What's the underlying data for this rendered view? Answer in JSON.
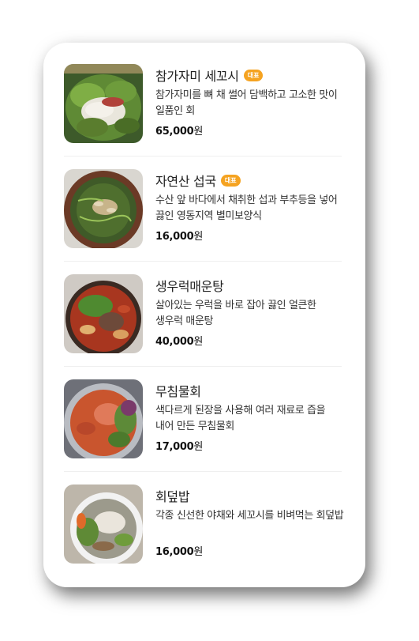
{
  "menu": {
    "items": [
      {
        "name": "참가자미 세꼬시",
        "badge": "대표",
        "description": "참가자미를 뼈 채 썰어 담백하고 고소한 맛이 일품인 회",
        "price": "65,000",
        "currency": "원",
        "image": "sliced-raw-flounder-with-greens"
      },
      {
        "name": "자연산 섭국",
        "badge": "대표",
        "description": "수산 앞 바다에서 채취한 섭과 부추등을 넣어 끓인 영동지역 별미보양식",
        "price": "16,000",
        "currency": "원",
        "image": "mussel-soup-in-clay-pot"
      },
      {
        "name": "생우럭매운탕",
        "badge": "",
        "description": "살아있는 우럭을 바로 잡아 끓인 얼큰한 생우럭 매운탕",
        "price": "40,000",
        "currency": "원",
        "image": "spicy-rockfish-stew"
      },
      {
        "name": "무침물회",
        "badge": "",
        "description": "색다르게 된장을 사용해 여러 재료로 즙을 내어 만든 무침물회",
        "price": "17,000",
        "currency": "원",
        "image": "cold-raw-fish-salad-bowl"
      },
      {
        "name": "회덮밥",
        "badge": "",
        "description": "각종 신선한 야채와 세꼬시를 비벼먹는 회덮밥",
        "price": "16,000",
        "currency": "원",
        "image": "raw-fish-bibimbap-bowl"
      }
    ]
  },
  "colors": {
    "badge": "#f5a321",
    "title": "#222222",
    "divider": "#efefef"
  }
}
